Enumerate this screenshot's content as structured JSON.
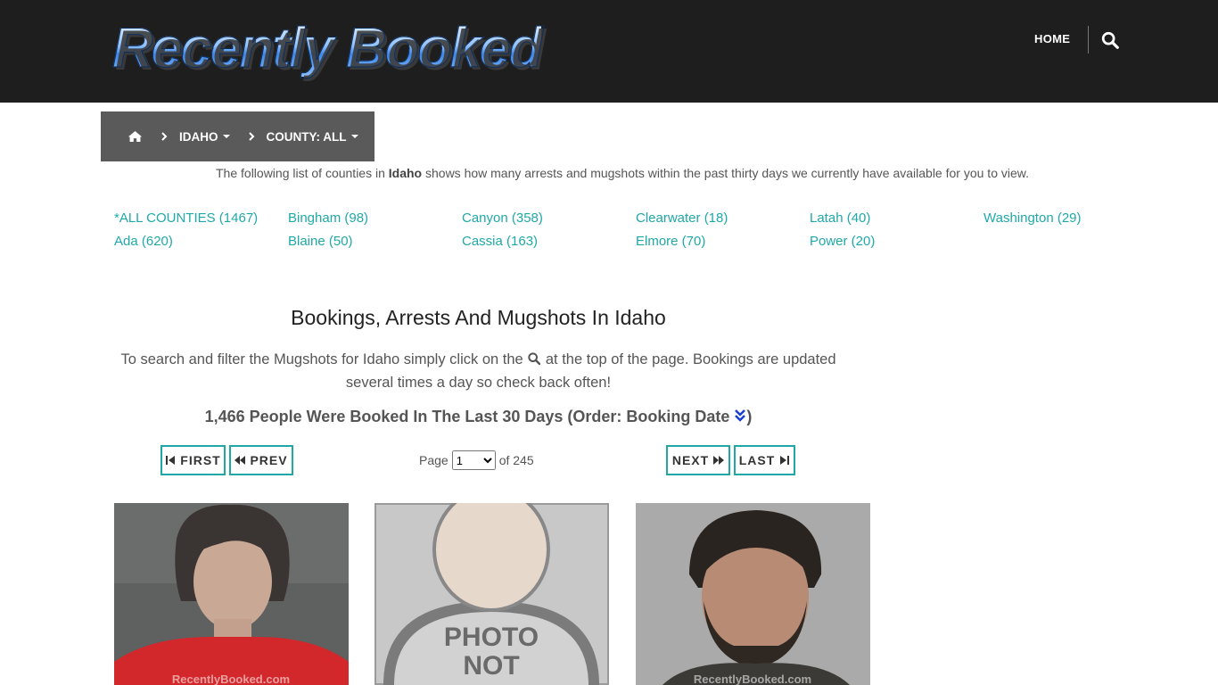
{
  "header": {
    "logo_text": "Recently Booked",
    "nav_home": "HOME",
    "search_icon": "search-icon"
  },
  "breadcrumb": {
    "home_icon": "home-icon",
    "state": "IDAHO",
    "county": "COUNTY: ALL"
  },
  "intro": {
    "before": "The following list of counties in ",
    "state": "Idaho",
    "after": " shows how many arrests and mugshots within the past thirty days we currently have available for you to view."
  },
  "counties": [
    {
      "label": "*ALL COUNTIES (1467)"
    },
    {
      "label": "Ada (620)"
    },
    {
      "label": "Bingham (98)"
    },
    {
      "label": "Blaine (50)"
    },
    {
      "label": "Canyon (358)"
    },
    {
      "label": "Cassia (163)"
    },
    {
      "label": "Clearwater (18)"
    },
    {
      "label": "Elmore (70)"
    },
    {
      "label": "Latah (40)"
    },
    {
      "label": "Power (20)"
    },
    {
      "label": "Washington (29)"
    }
  ],
  "main": {
    "title": "Bookings, Arrests And Mugshots In Idaho",
    "desc_before": "To search and filter the Mugshots for Idaho simply click on the ",
    "desc_after": " at the top of the page. Bookings are updated several times a day so check back often!",
    "count_line": "1,466 People Were Booked In The Last 30 Days (Order: Booking Date ",
    "count_close": ")"
  },
  "pager": {
    "first": "FIRST",
    "prev": "PREV",
    "next": "NEXT",
    "last": "LAST",
    "page_label": "Page",
    "current_page": "1",
    "of_label": "of 245"
  },
  "mugshots": [
    {
      "name": "mugshot-1",
      "watermark": "RecentlyBooked.com"
    },
    {
      "name": "photo-not-available",
      "text_line1": "PHOTO",
      "text_line2": "NOT"
    },
    {
      "name": "mugshot-3",
      "watermark": "RecentlyBooked.com"
    }
  ],
  "colors": {
    "accent": "#20a8a8",
    "header_bg": "#1e1e1e",
    "breadcrumb_bg": "#5a5a5a"
  }
}
